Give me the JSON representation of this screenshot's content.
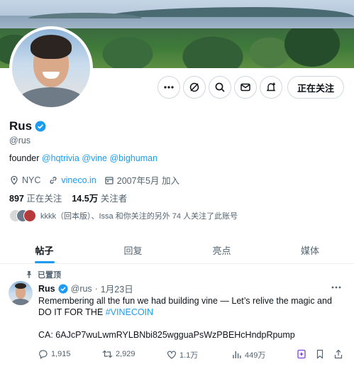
{
  "profile": {
    "display_name": "Rus",
    "handle": "@rus",
    "bio_prefix": "founder",
    "bio_mentions": [
      "@hqtrivia",
      "@vine",
      "@bighuman"
    ],
    "location": "NYC",
    "website": "vineco.in",
    "joined": "2007年5月 加入",
    "following_count": "897",
    "following_label": "正在关注",
    "followers_count": "14.5万",
    "followers_label": "关注者",
    "followed_by_text": "kkkk（回本版）、Issa 和你关注的另外 74 人关注了此账号",
    "follow_button": "正在关注"
  },
  "tabs": [
    {
      "label": "帖子",
      "active": true
    },
    {
      "label": "回复",
      "active": false
    },
    {
      "label": "亮点",
      "active": false
    },
    {
      "label": "媒体",
      "active": false
    }
  ],
  "tweet": {
    "pinned_label": "已置顶",
    "author_name": "Rus",
    "author_handle": "@rus",
    "separator": "·",
    "date": "1月23日",
    "text_main": "Remembering all the fun we had building vine — Let’s relive the magic and DO IT FOR THE ",
    "hashtag": "#VINECOIN",
    "ca_line": "CA: 6AJcP7wuLwmRYLBNbi825wgguaPsWzPBEHcHndpRpump",
    "replies": "1,915",
    "retweets": "2,929",
    "likes": "1.1万",
    "views": "449万"
  },
  "colors": {
    "accent": "#1d9bf0",
    "text": "#0f1419",
    "muted": "#536471",
    "border": "#cfd9de",
    "grok": "#7b3fe4"
  },
  "icons": [
    "more-icon",
    "grok-icon",
    "search-icon",
    "message-icon",
    "notify-icon",
    "verified-icon",
    "location-icon",
    "link-icon",
    "calendar-icon",
    "pin-icon",
    "reply-icon",
    "retweet-icon",
    "like-icon",
    "views-icon",
    "bookmark-icon",
    "share-icon"
  ]
}
